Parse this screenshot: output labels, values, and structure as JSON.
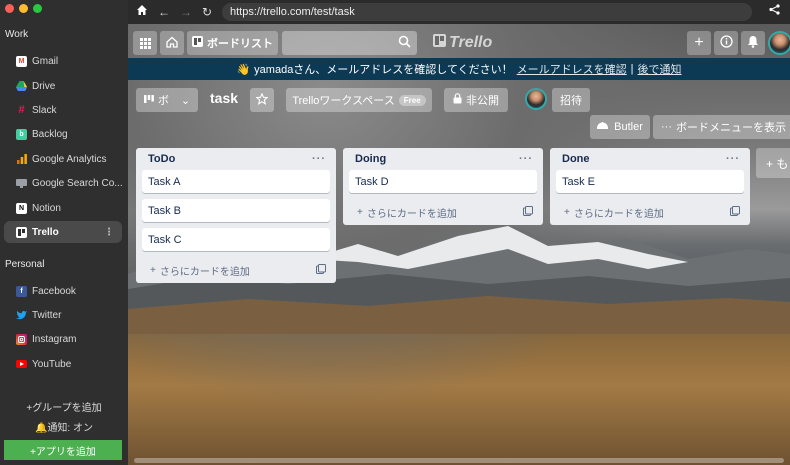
{
  "sidebar": {
    "work_title": "Work",
    "work_apps": [
      {
        "label": "Gmail",
        "icon": "gmail-icon",
        "color": "#d44638"
      },
      {
        "label": "Drive",
        "icon": "drive-icon",
        "color": "#1fa463"
      },
      {
        "label": "Slack",
        "icon": "slack-icon",
        "color": "#6f4a70"
      },
      {
        "label": "Backlog",
        "icon": "backlog-icon",
        "color": "#42ce9f"
      },
      {
        "label": "Google Analytics",
        "icon": "analytics-icon",
        "color": "#f9ab00"
      },
      {
        "label": "Google Search Co...",
        "icon": "search-console-icon",
        "color": "#9aa0a6"
      },
      {
        "label": "Notion",
        "icon": "notion-icon",
        "color": "#ffffff"
      },
      {
        "label": "Trello",
        "icon": "trello-icon",
        "color": "#ffffff",
        "active": true
      }
    ],
    "active_kebab": "⋮",
    "personal_title": "Personal",
    "personal_apps": [
      {
        "label": "Facebook",
        "icon": "facebook-icon",
        "color": "#3b5998"
      },
      {
        "label": "Twitter",
        "icon": "twitter-icon",
        "color": "#1da1f2"
      },
      {
        "label": "Instagram",
        "icon": "instagram-icon",
        "color": "#c13584"
      },
      {
        "label": "YouTube",
        "icon": "youtube-icon",
        "color": "#ff0000"
      }
    ],
    "add_group": "+グループを追加",
    "notifications": "通知: オン",
    "add_app": "+アプリを追加"
  },
  "browser": {
    "url": "https://trello.com/test/task"
  },
  "header": {
    "boards_label": "ボードリスト",
    "logo_text": "Trello"
  },
  "banner": {
    "emoji": "👋",
    "message": "yamadaさん、メールアドレスを確認してください！",
    "confirm_link": "メールアドレスを確認",
    "sep": "|",
    "later_link": "後で通知"
  },
  "board": {
    "view_label": "ボ",
    "title": "task",
    "workspace_label": "Trelloワークスペース",
    "free_badge": "Free",
    "visibility_label": "非公開",
    "invite_label": "招待",
    "butler_label": "Butler",
    "menu_label": "ボードメニューを表示",
    "add_list_label": "+ も"
  },
  "lists": [
    {
      "title": "ToDo",
      "cards": [
        "Task A",
        "Task B",
        "Task C"
      ]
    },
    {
      "title": "Doing",
      "cards": [
        "Task D"
      ]
    },
    {
      "title": "Done",
      "cards": [
        "Task E"
      ]
    }
  ],
  "list_ui": {
    "menu_glyph": "···",
    "add_card_label": "さらにカードを追加"
  },
  "colors": {
    "banner_bg": "#0c3953",
    "add_app_bg": "#4cb050",
    "list_bg": "#ebecf0"
  }
}
